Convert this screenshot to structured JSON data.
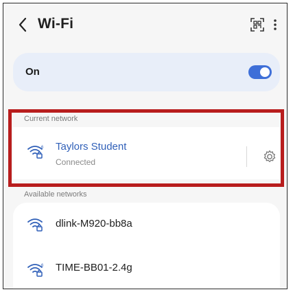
{
  "header": {
    "title": "Wi-Fi",
    "back_icon": "chevron-left-icon",
    "scan_icon": "qr-scan-icon",
    "more_icon": "more-vertical-icon"
  },
  "wifi_toggle": {
    "label": "On",
    "enabled": true,
    "accent_color": "#3e6fd8"
  },
  "current_network": {
    "section_label": "Current network",
    "name": "Taylors Student",
    "status": "Connected",
    "name_color": "#2f5fb8",
    "icon": "wifi-secured-icon",
    "settings_icon": "gear-icon"
  },
  "available_networks": {
    "section_label": "Available networks",
    "items": [
      {
        "name": "dlink-M920-bb8a",
        "icon": "wifi-secured-icon"
      },
      {
        "name": "TIME-BB01-2.4g",
        "icon": "wifi-6-secured-icon"
      }
    ]
  },
  "highlight_color": "#b81d1d"
}
